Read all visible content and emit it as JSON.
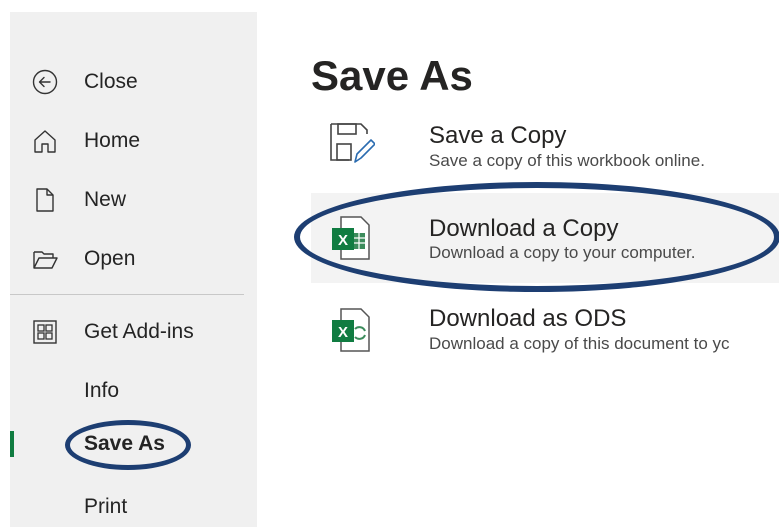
{
  "sidebar": {
    "items": [
      {
        "label": "Close",
        "icon": "back-arrow-icon"
      },
      {
        "label": "Home",
        "icon": "home-icon"
      },
      {
        "label": "New",
        "icon": "new-document-icon"
      },
      {
        "label": "Open",
        "icon": "folder-open-icon"
      },
      {
        "label": "Get Add-ins",
        "icon": "add-ins-grid-icon"
      },
      {
        "label": "Info"
      },
      {
        "label": "Save As",
        "active": true
      },
      {
        "label": "Print"
      }
    ]
  },
  "main": {
    "title": "Save As",
    "options": [
      {
        "title": "Save a Copy",
        "description": "Save a copy of this workbook online.",
        "icon": "save-copy-icon"
      },
      {
        "title": "Download a Copy",
        "description": "Download a copy to your computer.",
        "icon": "excel-download-icon"
      },
      {
        "title": "Download as ODS",
        "description": "Download a copy of this document to yc",
        "icon": "excel-ods-icon"
      }
    ]
  },
  "colors": {
    "sidebar_bg": "#f0f0f0",
    "accent_green": "#107c41",
    "annotation_blue": "#1d3e72"
  }
}
